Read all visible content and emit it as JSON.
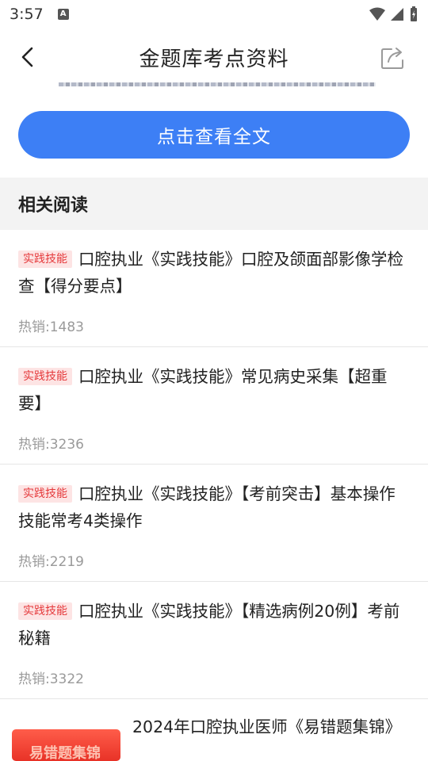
{
  "status": {
    "time": "3:57",
    "notif_icon": "A"
  },
  "header": {
    "title": "金题库考点资料"
  },
  "cta": {
    "label": "点击查看全文"
  },
  "section": {
    "title": "相关阅读"
  },
  "items": [
    {
      "tag": "实践技能",
      "title": "口腔执业《实践技能》口腔及颌面部影像学检查【得分要点】",
      "hot": "热销:1483"
    },
    {
      "tag": "实践技能",
      "title": "口腔执业《实践技能》常见病史采集【超重要】",
      "hot": "热销:3236"
    },
    {
      "tag": "实践技能",
      "title": "口腔执业《实践技能》【考前突击】基本操作技能常考4类操作",
      "hot": "热销:2219"
    },
    {
      "tag": "实践技能",
      "title": "口腔执业《实践技能》【精选病例20例】考前秘籍",
      "hot": "热销:3322"
    }
  ],
  "book": {
    "title": "2024年口腔执业医师《易错题集锦》",
    "cover_text": "易错题集锦"
  },
  "colors": {
    "accent": "#3d7ff5",
    "tag_bg": "#fde4e4",
    "tag_text": "#e5393b"
  }
}
